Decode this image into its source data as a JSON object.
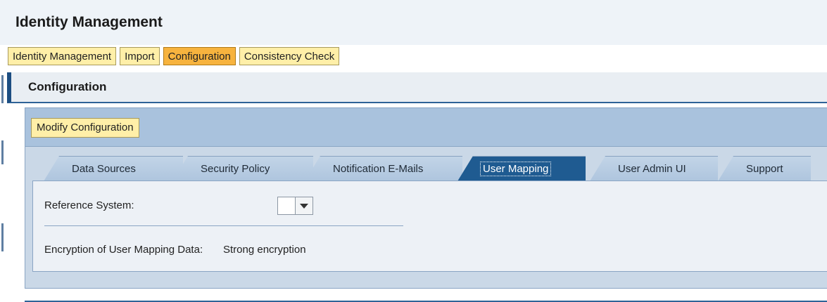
{
  "app": {
    "title": "Identity Management"
  },
  "top_tabs": [
    {
      "label": "Identity Management",
      "active": false
    },
    {
      "label": "Import",
      "active": false
    },
    {
      "label": "Configuration",
      "active": true
    },
    {
      "label": "Consistency Check",
      "active": false
    }
  ],
  "section": {
    "title": "Configuration"
  },
  "toolbar": {
    "modify_label": "Modify Configuration"
  },
  "tabs": [
    {
      "label": "Data Sources",
      "active": false
    },
    {
      "label": "Security Policy",
      "active": false
    },
    {
      "label": "Notification E-Mails",
      "active": false
    },
    {
      "label": "User Mapping",
      "active": true
    },
    {
      "label": "User Admin UI",
      "active": false
    },
    {
      "label": "Support",
      "active": false
    }
  ],
  "form": {
    "reference_label": "Reference System:",
    "reference_value": "",
    "encryption_label": "Encryption of User Mapping Data:",
    "encryption_value": "Strong encryption"
  },
  "colors": {
    "accent": "#1f5b91",
    "active_top_tab": "#f7b33e",
    "button_bg": "#ffefa8"
  }
}
